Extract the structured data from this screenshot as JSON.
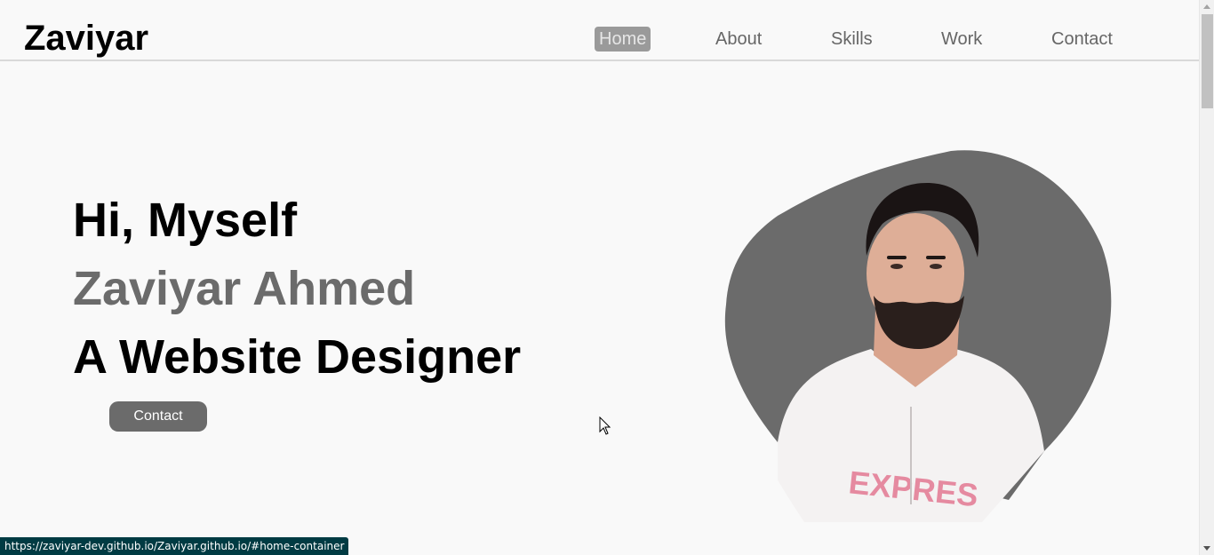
{
  "header": {
    "brand": "Zaviyar",
    "nav": [
      {
        "label": "Home",
        "active": true
      },
      {
        "label": "About",
        "active": false
      },
      {
        "label": "Skills",
        "active": false
      },
      {
        "label": "Work",
        "active": false
      },
      {
        "label": "Contact",
        "active": false
      }
    ]
  },
  "hero": {
    "greeting": "Hi, Myself",
    "name": "Zaviyar Ahmed",
    "role": "A Website Designer",
    "cta_label": "Contact",
    "image_icon": "profile-photo"
  },
  "status_bar": {
    "url": "https://zaviyar-dev.github.io/Zaviyar.github.io/#home-container"
  },
  "colors": {
    "background": "#f9f9f9",
    "accent_gray": "#6b6b6b",
    "nav_active_bg": "#9a9a9a",
    "status_bar_bg": "#003b43"
  }
}
